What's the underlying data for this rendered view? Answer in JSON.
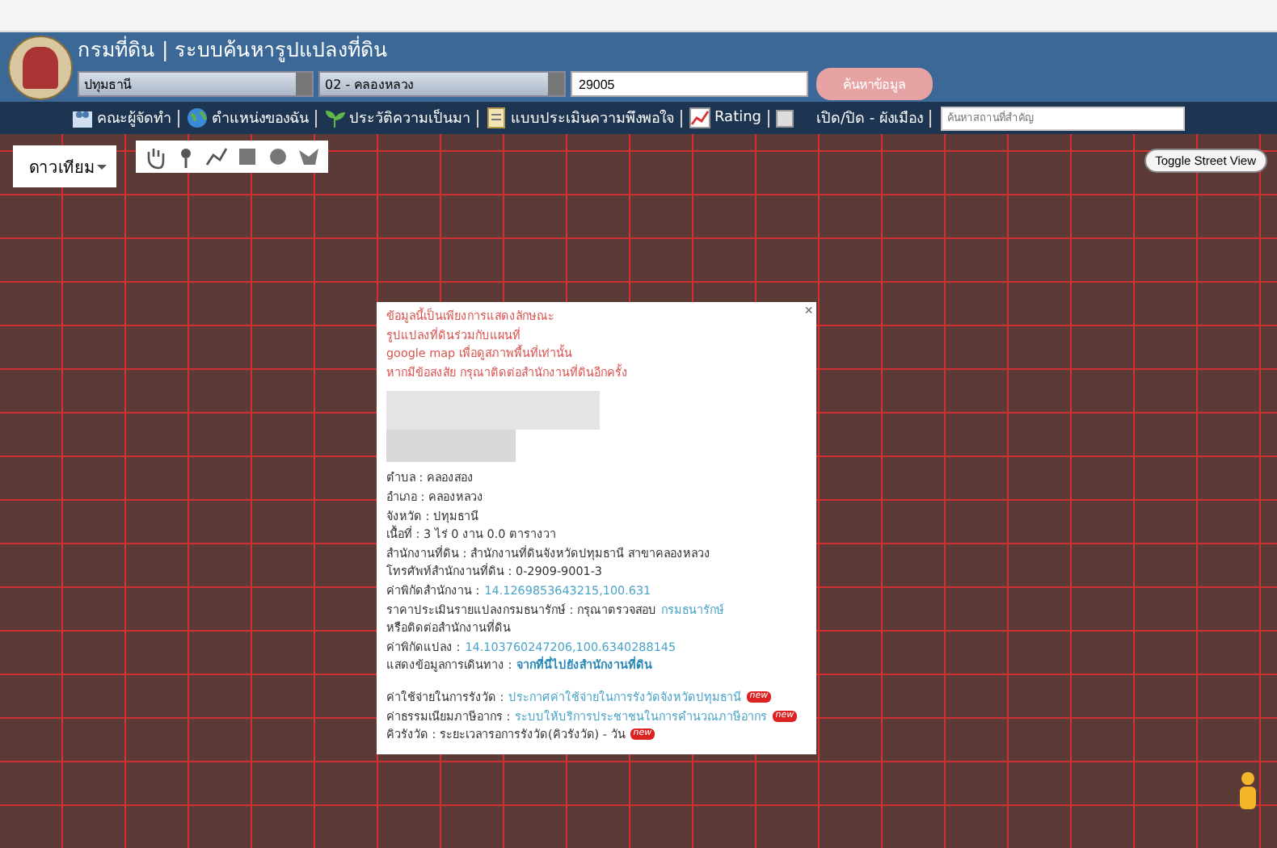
{
  "header": {
    "title": "กรมที่ดิน | ระบบค้นหารูปแปลงที่ดิน",
    "province": "ปทุมธานี",
    "district": "02 - คลองหลวง",
    "parcel_no": "29005",
    "search_button": "ค้นหาข้อมูล"
  },
  "menu": [
    {
      "kind": "link",
      "label": "คณะผู้จัดทำ"
    },
    {
      "kind": "link",
      "label": "ตำแหน่งของฉัน"
    },
    {
      "kind": "link",
      "label": "ประวัติความเป็นมา"
    },
    {
      "kind": "link",
      "label": "แบบประเมินความพึงพอใจ"
    },
    {
      "kind": "link",
      "label": "Rating"
    },
    {
      "kind": "checkbox",
      "label": "เปิด/ปิด - ผังเมือง",
      "checked": false
    }
  ],
  "place_search": {
    "placeholder": "ค้นหาสถานที่สำคัญ"
  },
  "map": {
    "map_type": "ดาวเทียม",
    "street_view_button": "Toggle Street View"
  },
  "popup": {
    "close": "×",
    "notice": [
      "ข้อมูลนี้เป็นเพียงการแสดงลักษณะ",
      "รูปแปลงที่ดินร่วมกับแผนที่",
      "google map เพื่อดูสภาพพื้นที่เท่านั้น",
      "หากมีข้อสงสัย กรุณาติดต่อสำนักงานที่ดินอีกครั้ง"
    ],
    "details": [
      [
        {
          "kind": "plain",
          "text": "ตำบล : คลองสอง"
        }
      ],
      [
        {
          "kind": "plain",
          "text": "อำเภอ : คลองหลวง"
        }
      ],
      [
        {
          "kind": "plain",
          "text": "จังหวัด : ปทุมธานี"
        }
      ],
      [
        {
          "kind": "plain",
          "text": "เนื้อที่ : 3 ไร่ 0 งาน 0.0 ตารางวา"
        }
      ],
      [
        {
          "kind": "plain",
          "text": "สำนักงานที่ดิน : สำนักงานที่ดินจังหวัดปทุมธานี สาขาคลองหลวง"
        }
      ],
      [
        {
          "kind": "plain",
          "text": "โทรศัพท์สำนักงานที่ดิน : 0-2909-9001-3"
        }
      ],
      [
        {
          "kind": "plain",
          "text": "ค่าพิกัดสำนักงาน :"
        },
        {
          "kind": "link",
          "text": "14.1269853643215,100.631"
        }
      ],
      [
        {
          "kind": "plain",
          "text": "ราคาประเมินรายแปลงกรมธนารักษ์ : กรุณาตรวจสอบ"
        },
        {
          "kind": "link",
          "text": "กรมธนารักษ์"
        }
      ],
      [
        {
          "kind": "plain",
          "text": "หรือติดต่อสำนักงานที่ดิน"
        }
      ],
      [
        {
          "kind": "plain",
          "text": "ค่าพิกัดแปลง :"
        },
        {
          "kind": "link",
          "text": "14.103760247206,100.6340288145"
        }
      ],
      [
        {
          "kind": "plain",
          "text": "แสดงข้อมูลการเดินทาง :"
        },
        {
          "kind": "bold_link",
          "text": "จากที่นี่ไปยังสำนักงานที่ดิน"
        }
      ]
    ],
    "services": [
      [
        {
          "kind": "plain",
          "text": "ค่าใช้จ่ายในการรังวัด :"
        },
        {
          "kind": "link",
          "text": "ประกาศค่าใช้จ่ายในการรังวัดจังหวัดปทุมธานี"
        },
        {
          "kind": "badge",
          "text": "new"
        }
      ],
      [
        {
          "kind": "plain",
          "text": "ค่าธรรมเนียมภาษีอากร :"
        },
        {
          "kind": "link",
          "text": "ระบบให้บริการประชาชนในการคำนวณภาษีอากร"
        },
        {
          "kind": "badge",
          "text": "new"
        }
      ],
      [
        {
          "kind": "plain",
          "text": "คิวรังวัด : ระยะเวลารอการรังวัด(คิวรังวัด) - วัน"
        },
        {
          "kind": "badge",
          "text": "new"
        }
      ]
    ]
  }
}
